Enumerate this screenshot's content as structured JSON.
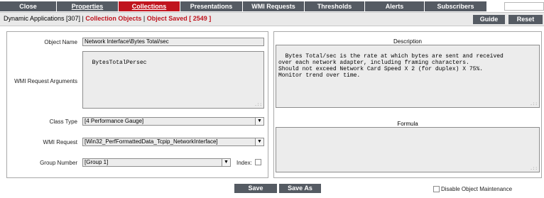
{
  "tabs": [
    {
      "label": "Close",
      "active": false
    },
    {
      "label": "Properties",
      "active": false
    },
    {
      "label": "Collections",
      "active": true
    },
    {
      "label": "Presentations",
      "active": false
    },
    {
      "label": "WMI Requests",
      "active": false
    },
    {
      "label": "Thresholds",
      "active": false
    },
    {
      "label": "Alerts",
      "active": false
    },
    {
      "label": "Subscribers",
      "active": false
    }
  ],
  "breadcrumb": {
    "prefix": "Dynamic Applications [307] | ",
    "collection": "Collection Objects",
    "sep": " | ",
    "saved": "Object Saved [ 2549 ]"
  },
  "toolbar": {
    "guide": "Guide",
    "reset": "Reset"
  },
  "form": {
    "object_name_label": "Object Name",
    "object_name_value": "Network Interface\\Bytes Total/sec",
    "wmi_args_label": "WMI Request Arguments",
    "wmi_args_value": "BytesTotalPersec",
    "class_type_label": "Class Type",
    "class_type_value": "[4 Performance Gauge]",
    "wmi_request_label": "WMI Request",
    "wmi_request_value": "[Win32_PerfFormattedData_Tcpip_NetworkInterface]",
    "group_number_label": "Group Number",
    "group_number_value": "[Group 1]",
    "index_label": "Index:",
    "index_checked": false
  },
  "description": {
    "label": "Description",
    "text": "Bytes Total/sec is the rate at which bytes are sent and received\nover each network adapter, including framing characters.\nShould not exceed Network Card Speed X 2 (for duplex) X 75%.\nMonitor trend over time."
  },
  "formula": {
    "label": "Formula",
    "text": ""
  },
  "bottom": {
    "save": "Save",
    "save_as": "Save As",
    "disable_label": "Disable Object Maintenance",
    "disable_checked": false
  },
  "colors": {
    "tab_bg": "#555b63",
    "active_tab": "#c0141e",
    "field_bg": "#ececec"
  }
}
